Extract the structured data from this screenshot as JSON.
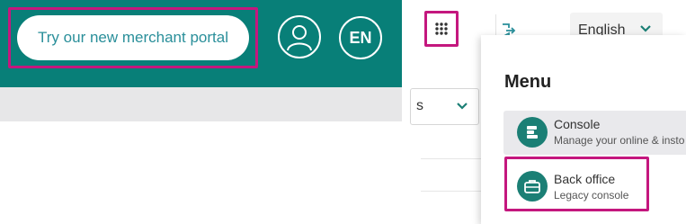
{
  "header": {
    "portal_button": "Try our new merchant portal",
    "language_code": "EN"
  },
  "top_right": {
    "language_select": "English"
  },
  "partial_dropdown": {
    "value_fragment": "s"
  },
  "menu": {
    "title": "Menu",
    "items": [
      {
        "title": "Console",
        "subtitle": "Manage your online & insto",
        "icon": "console-icon"
      },
      {
        "title": "Back office",
        "subtitle": "Legacy console",
        "icon": "briefcase-icon"
      }
    ]
  },
  "colors": {
    "teal": "#087f78",
    "highlight": "#c4177e",
    "icon_teal": "#1b7f75",
    "link_teal": "#2a8f9a"
  }
}
